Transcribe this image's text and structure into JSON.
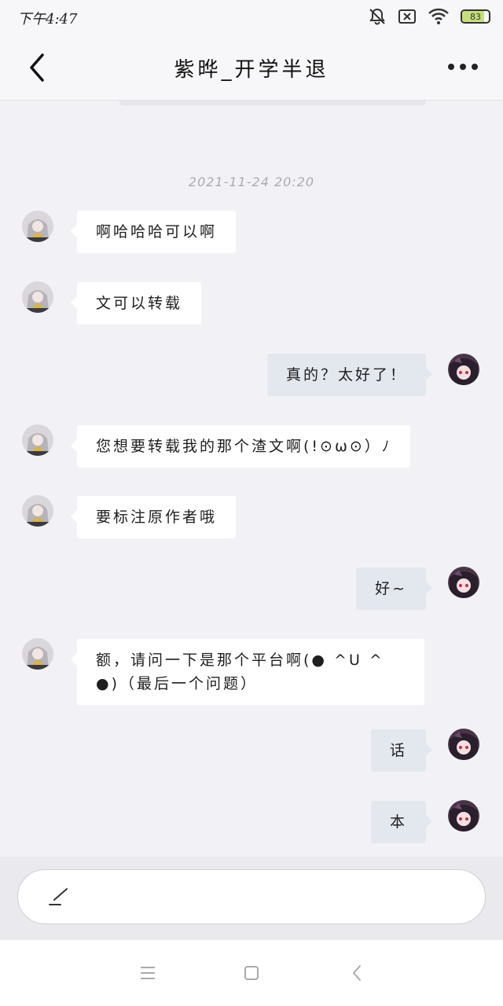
{
  "status_bar": {
    "time": "下午4:47",
    "battery": "83",
    "battery_level_percent": 83,
    "icons": [
      "mute-icon",
      "sim-off-icon",
      "wifi-icon",
      "battery-icon"
    ]
  },
  "header": {
    "title": "紫晔_开学半退",
    "back_icon": "chevron-left-icon",
    "more_icon": "more-dots-icon"
  },
  "chat": {
    "timestamp": "2021-11-24 20:20",
    "messages": [
      {
        "sender": "other",
        "text": "啊哈哈哈可以啊"
      },
      {
        "sender": "other",
        "text": "文可以转载"
      },
      {
        "sender": "me",
        "text": "真的？太好了！"
      },
      {
        "sender": "other",
        "text": "您想要转载我的那个渣文啊(!⊙ω⊙）ﾉ"
      },
      {
        "sender": "other",
        "text": "要标注原作者哦"
      },
      {
        "sender": "me",
        "text": "好~"
      },
      {
        "sender": "other",
        "text": "额，请问一下是那个平台啊(● ^U ^ ●)（最后一个问题）"
      },
      {
        "sender": "me",
        "text": "话"
      },
      {
        "sender": "me",
        "text": "本"
      }
    ]
  },
  "input": {
    "placeholder": "",
    "icon": "pen-icon"
  },
  "system_nav": {
    "icons": [
      "menu-icon",
      "home-icon",
      "back-icon"
    ]
  },
  "colors": {
    "background": "#f2f2f6",
    "incoming_bubble": "#ffffff",
    "outgoing_bubble": "#e3e7ee",
    "timestamp": "#a9a9b0"
  }
}
